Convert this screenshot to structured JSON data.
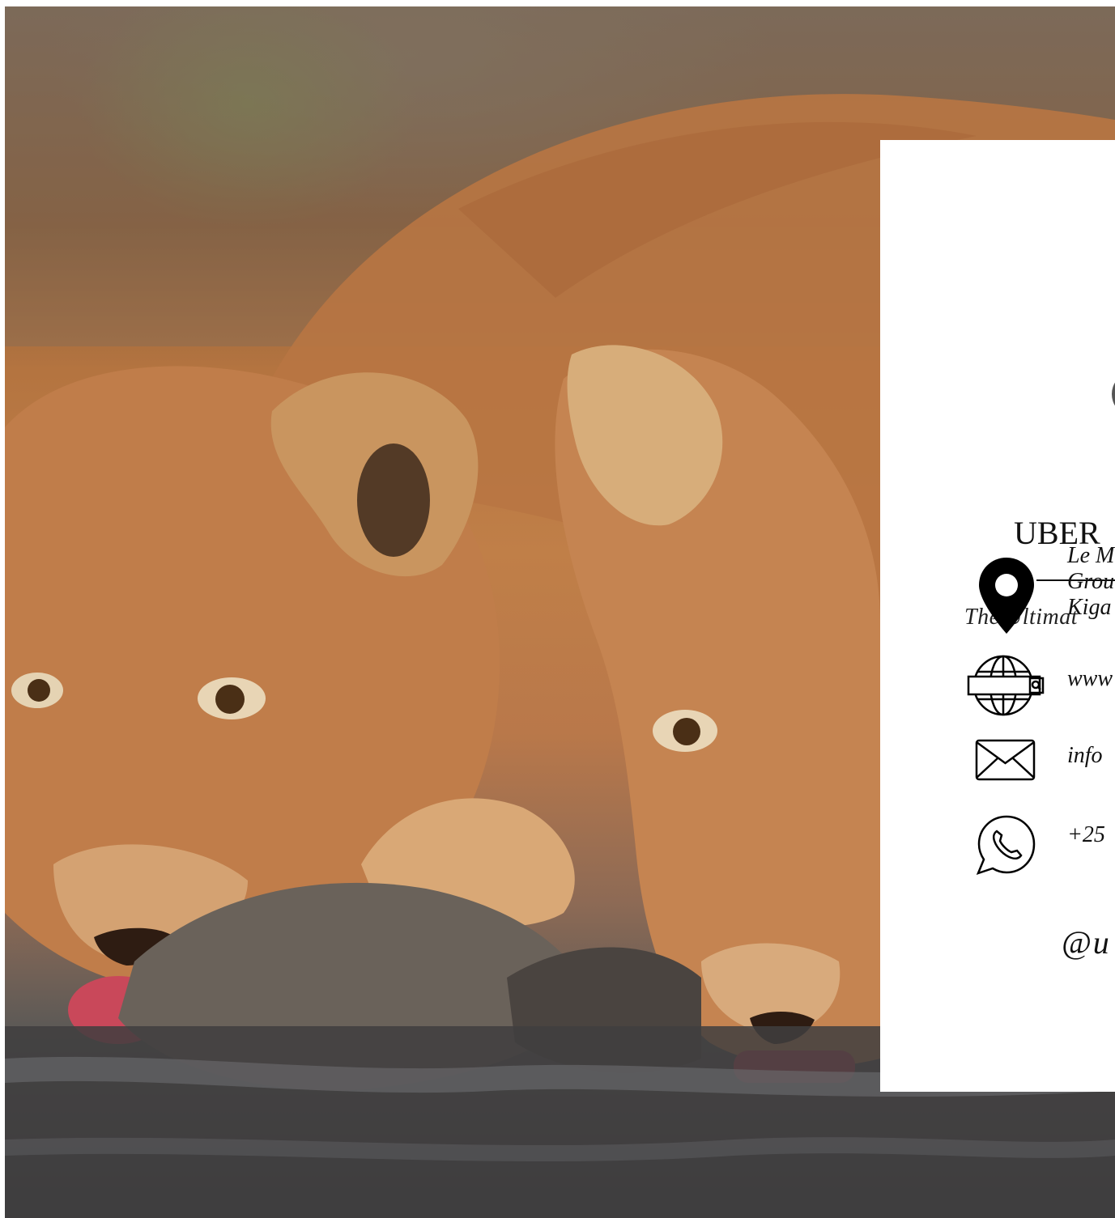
{
  "photo": {
    "subject": "lion-cubs-drinking-photo"
  },
  "card": {
    "brand_title": "UBER",
    "tagline": "The Ultimat",
    "address": {
      "line1": "Le M",
      "line2": "Grou",
      "line3": "Kiga"
    },
    "website": "www",
    "email": "info",
    "phone": "+25",
    "handle": "@u"
  },
  "icons": {
    "location": "location-pin-icon",
    "web": "globe-icon",
    "email": "envelope-icon",
    "phone": "whatsapp-icon"
  },
  "colors": {
    "card_background": "#ffffff",
    "text": "#111111"
  }
}
